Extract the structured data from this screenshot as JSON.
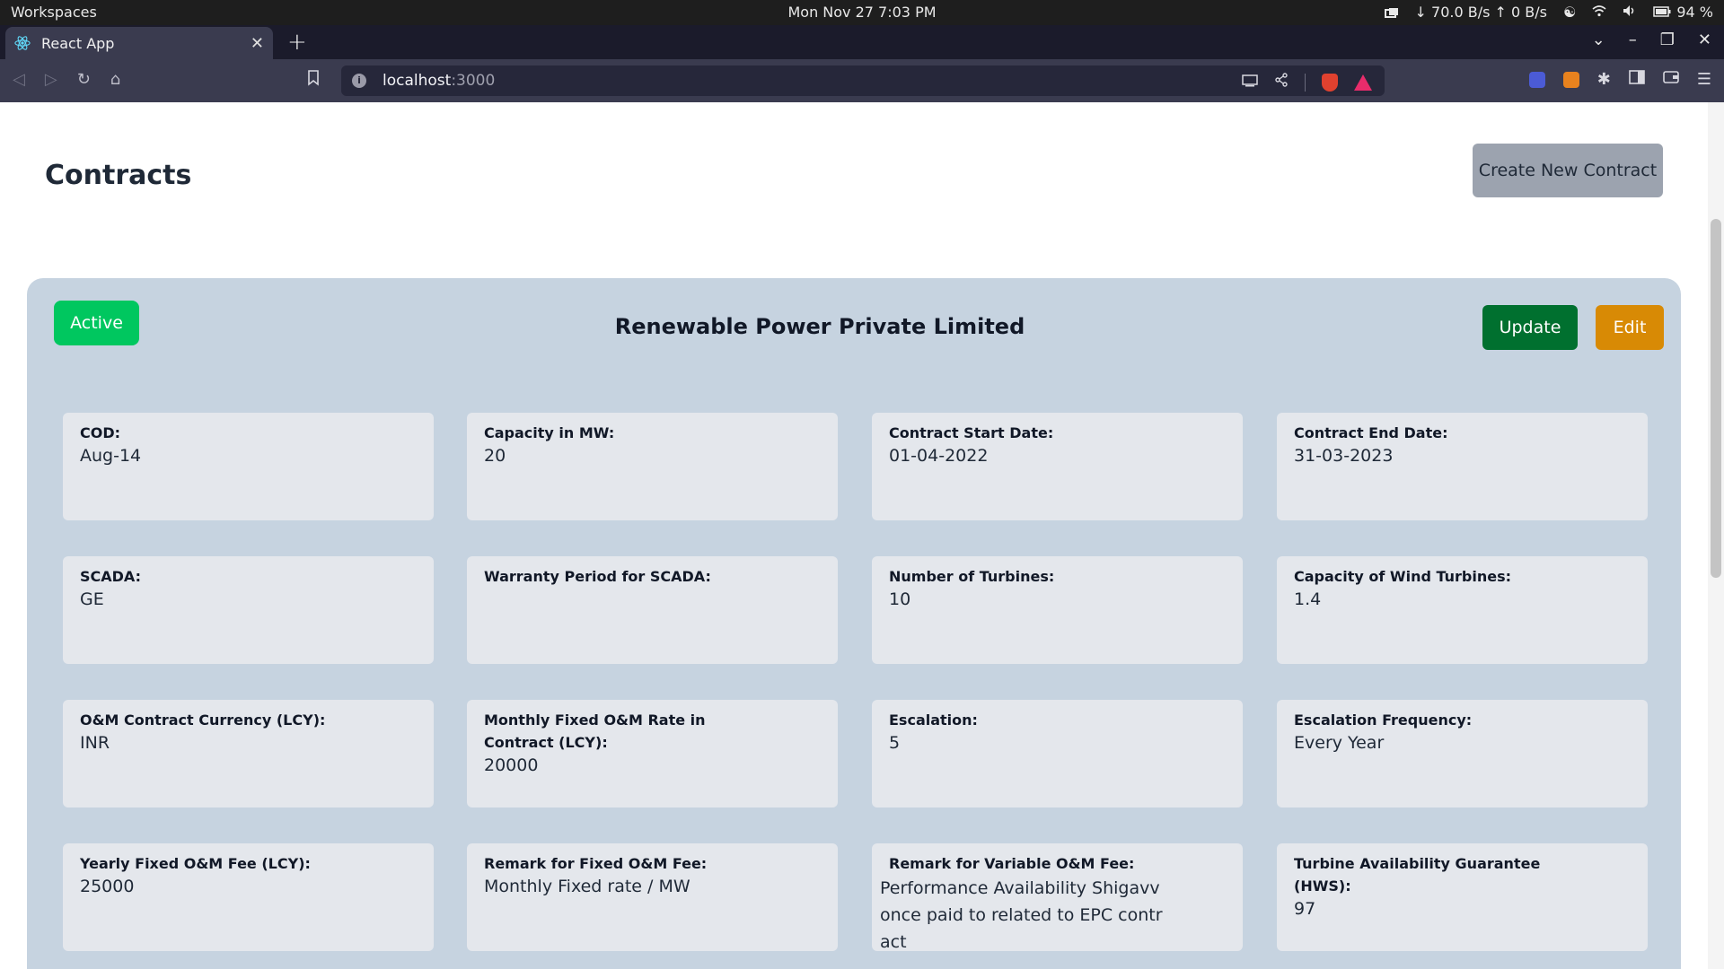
{
  "os": {
    "workspaces": "Workspaces",
    "datetime": "Mon Nov 27   7:03 PM",
    "network": "↓ 70.0 B/s ↑ 0 B/s",
    "battery": "94 %"
  },
  "browser": {
    "tab_title": "React App",
    "url_host": "localhost",
    "url_port": ":3000"
  },
  "page": {
    "title": "Contracts",
    "create_button": "Create New Contract"
  },
  "contract": {
    "status": "Active",
    "company": "Renewable Power Private Limited",
    "update_button": "Update",
    "edit_button": "Edit",
    "fields": [
      {
        "label": "COD:",
        "value": "Aug-14"
      },
      {
        "label": "Capacity in MW:",
        "value": "20"
      },
      {
        "label": "Contract Start Date:",
        "value": "01-04-2022"
      },
      {
        "label": "Contract End Date:",
        "value": "31-03-2023"
      },
      {
        "label": "SCADA:",
        "value": "GE"
      },
      {
        "label": "Warranty Period for SCADA:",
        "value": ""
      },
      {
        "label": "Number of Turbines:",
        "value": "10"
      },
      {
        "label": "Capacity of Wind Turbines:",
        "value": "1.4"
      },
      {
        "label": "O&M Contract Currency (LCY):",
        "value": "INR"
      },
      {
        "label": "Monthly Fixed O&M Rate in Contract (LCY):",
        "value": "20000"
      },
      {
        "label": "Escalation:",
        "value": "5"
      },
      {
        "label": "Escalation Frequency:",
        "value": "Every Year"
      },
      {
        "label": "Yearly Fixed O&M Fee (LCY):",
        "value": "25000"
      },
      {
        "label": "Remark for Fixed O&M Fee:",
        "value": "Monthly Fixed rate / MW"
      },
      {
        "label": "Remark for Variable O&M Fee:",
        "value": " Performance Availability Shigavv once paid to related to EPC contract"
      },
      {
        "label": "Turbine Availability Guarantee (HWS):",
        "value": "97"
      }
    ]
  }
}
